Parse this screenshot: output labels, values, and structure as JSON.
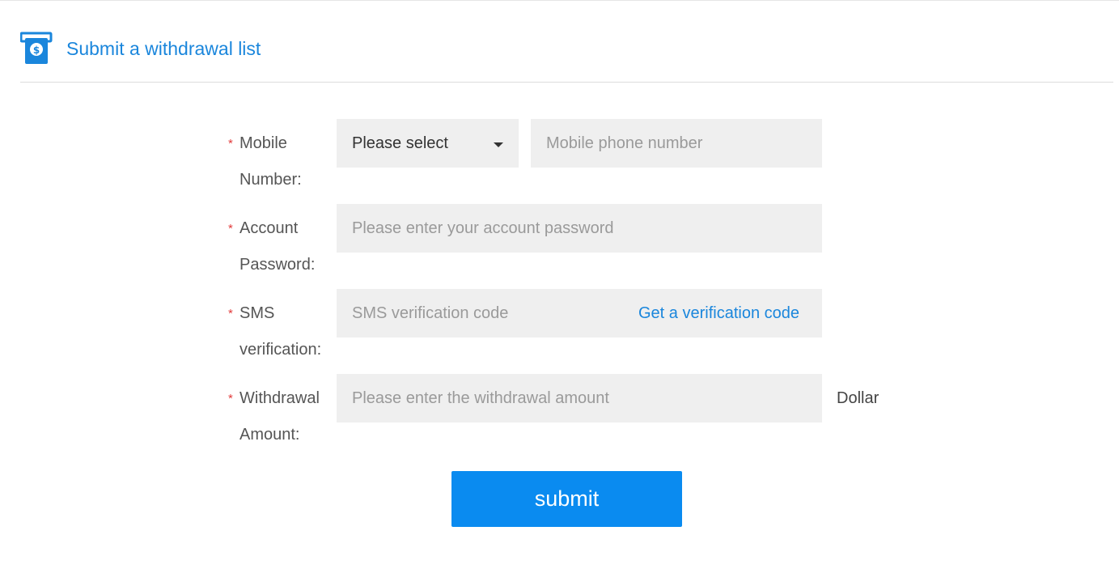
{
  "header": {
    "title": "Submit a withdrawal list",
    "icon": "atm-cash-icon",
    "accent": "#1a86dc"
  },
  "form": {
    "mobile": {
      "label_line1": "Mobile",
      "label_line2": "Number:",
      "select_value": "Please select",
      "placeholder": "Mobile phone number"
    },
    "password": {
      "label_line1": "Account",
      "label_line2": "Password:",
      "placeholder": "Please enter your account password"
    },
    "sms": {
      "label_line1": "SMS",
      "label_line2": "verification:",
      "placeholder": "SMS verification code",
      "link": "Get a verification code"
    },
    "amount": {
      "label_line1": "Withdrawal",
      "label_line2": "Amount:",
      "placeholder": "Please enter the withdrawal amount",
      "unit": "Dollar"
    },
    "required_mark": "*",
    "submit_label": "submit",
    "button_color": "#0a8bf0"
  }
}
